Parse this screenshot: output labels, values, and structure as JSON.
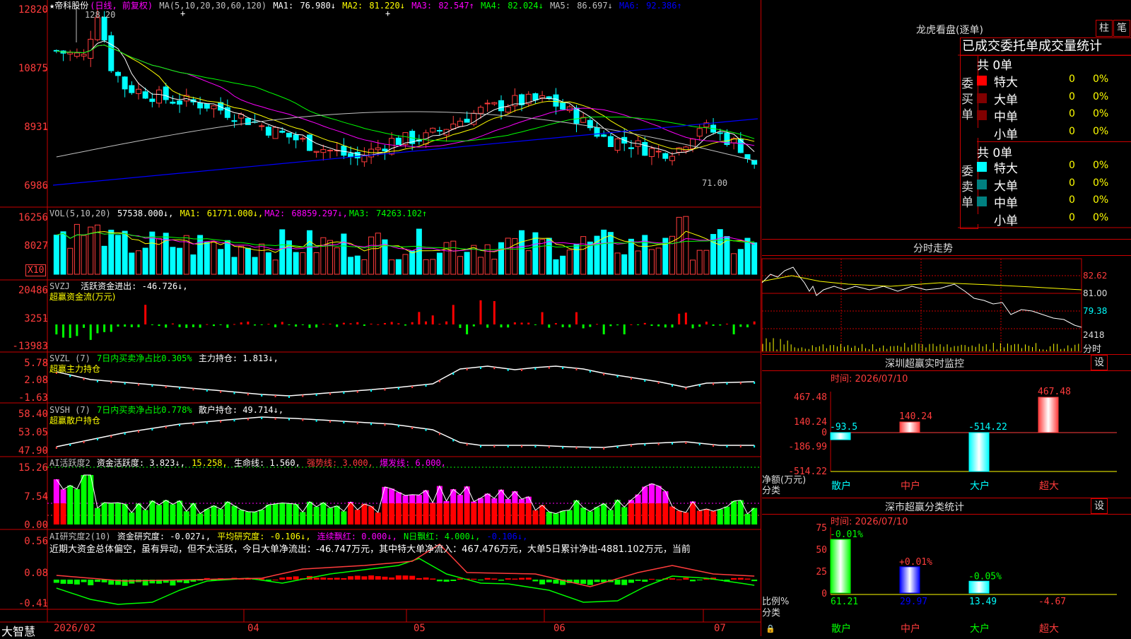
{
  "main": {
    "title": "★帝科股份",
    "mode": "(日线, 前复权)",
    "ma_label": "MA(5,10,20,30,60,120)",
    "ma": [
      {
        "name": "MA1:",
        "value": "76.980↓",
        "color": "#ffffff"
      },
      {
        "name": "MA2:",
        "value": "81.220↓",
        "color": "#ffff00"
      },
      {
        "name": "MA3:",
        "value": "82.547↑",
        "color": "#ff00ff"
      },
      {
        "name": "MA4:",
        "value": "82.024↓",
        "color": "#00ff00"
      },
      {
        "name": "MA5:",
        "value": "86.697↓",
        "color": "#c0c0c0"
      },
      {
        "name": "MA6:",
        "value": "92.386↑",
        "color": "#0000ff"
      }
    ],
    "yaxis": [
      "12820",
      "10875",
      "8931",
      "6986"
    ],
    "high_label": "128.20",
    "low_label": "71.00"
  },
  "vol": {
    "label": "VOL(5,10,20)",
    "value": "57538.000↓,",
    "ma": [
      {
        "name": "MA1:",
        "value": "61771.000↓,",
        "color": "#ffff00"
      },
      {
        "name": "MA2:",
        "value": "68859.297↓,",
        "color": "#ff00ff"
      },
      {
        "name": "MA3:",
        "value": "74263.102↑",
        "color": "#00ff00"
      }
    ],
    "yaxis": [
      "16256",
      "8027"
    ],
    "unit": "X10"
  },
  "svzj": {
    "label": "SVZJ",
    "text": "活跃资金进出: -46.726↓,",
    "sub": "超赢资金流(万元)",
    "yaxis": [
      "20486",
      "3251",
      "-13983"
    ]
  },
  "svzl": {
    "label": "SVZL (7)",
    "text1": "7日内买卖净占比0.305%",
    "text2": "主力持仓: 1.813↓,",
    "sub": "超赢主力持仓",
    "yaxis": [
      "5.78",
      "2.08",
      "-1.63"
    ]
  },
  "svsh": {
    "label": "SVSH (7)",
    "text1": "7日内买卖净占比0.778%",
    "text2": "散户持仓: 49.714↓,",
    "sub": "超赢散户持仓",
    "yaxis": [
      "58.40",
      "53.05",
      "47.90"
    ]
  },
  "ai1": {
    "label": "AI活跃度2",
    "t1": "资金活跃度: 3.823↓,",
    "t2": "15.258,",
    "t3": "生命线: 1.560,",
    "t4": "强势线: 3.000,",
    "t5": "爆发线: 6.000,",
    "yaxis": [
      "15.26",
      "7.54",
      "0.00"
    ]
  },
  "ai2": {
    "label": "AI研究度2(10)",
    "t1": "资金研究度: -0.027↓,",
    "t2": "平均研究度: -0.106↓,",
    "t3": "连续飘红: 0.000↓,",
    "t4": "N日飘红: 4.000↓,",
    "t5": "-0.106↓,",
    "note": "近期大资金总体偏空，虽有异动，但不太活跃，今日大单净流出：-46.747万元，其中特大单净流入：467.476万元，大单5日累计净出-4881.102万元，当前",
    "yaxis": [
      "0.56",
      "0.08",
      "-0.41"
    ]
  },
  "xaxis": {
    "brand": "大智慧",
    "labels": [
      "2026/02",
      "04",
      "05",
      "06",
      "07"
    ]
  },
  "lhb": {
    "title": "龙虎看盘(逐单)",
    "btn1": "柱",
    "btn2": "笔",
    "tabs": "已成交委托单成交量统计",
    "buy_label": "委买单",
    "sell_label": "委卖单",
    "buy_total": "共 0单",
    "sell_total": "共 0单",
    "rows": [
      {
        "name": "特大",
        "count": "0",
        "pct": "0%"
      },
      {
        "name": "大单",
        "count": "0",
        "pct": "0%"
      },
      {
        "name": "中单",
        "count": "0",
        "pct": "0%"
      },
      {
        "name": "小单",
        "count": "0",
        "pct": "0%"
      }
    ],
    "buy_colors": [
      "#ff0000",
      "#800000",
      "#800000",
      "#000000"
    ],
    "sell_colors": [
      "#00ffff",
      "#008080",
      "#008080",
      "#000000"
    ]
  },
  "fenshi": {
    "title": "分时走势",
    "y": [
      "82.62",
      "81.00",
      "79.38",
      "2418"
    ],
    "unit": "分时"
  },
  "monitor": {
    "title": "深圳超赢实时监控",
    "gear": "设",
    "time": "时间: 2026/07/10",
    "yaxis": [
      "467.48",
      "140.24",
      "0",
      "-186.99",
      "-514.22"
    ],
    "left1": "净额(万元)",
    "left2": "分类",
    "chart_data": {
      "type": "bar",
      "categories": [
        "散户",
        "中户",
        "大户",
        "超大"
      ],
      "values": [
        -93.5,
        140.24,
        -514.22,
        467.48
      ],
      "ylim": [
        -514.22,
        467.48
      ]
    },
    "labels": [
      "-93.5",
      "140.24",
      "-514.22",
      "467.48"
    ]
  },
  "classify": {
    "title": "深市超赢分类统计",
    "gear": "设",
    "time": "时间: 2026/07/10",
    "yaxis": [
      "75",
      "50",
      "25",
      "0"
    ],
    "left1": "比例%",
    "left2": "分类",
    "chart_data": {
      "type": "bar",
      "categories": [
        "散户",
        "中户",
        "大户",
        "超大"
      ],
      "values": [
        61.21,
        29.97,
        13.49,
        -4.67
      ],
      "changes": [
        "-0.01%",
        "+0.01%",
        "-0.05%",
        ""
      ],
      "ylim": [
        0,
        75
      ]
    },
    "bottom": [
      "61.21",
      "29.97",
      "13.49",
      "-4.67"
    ]
  }
}
